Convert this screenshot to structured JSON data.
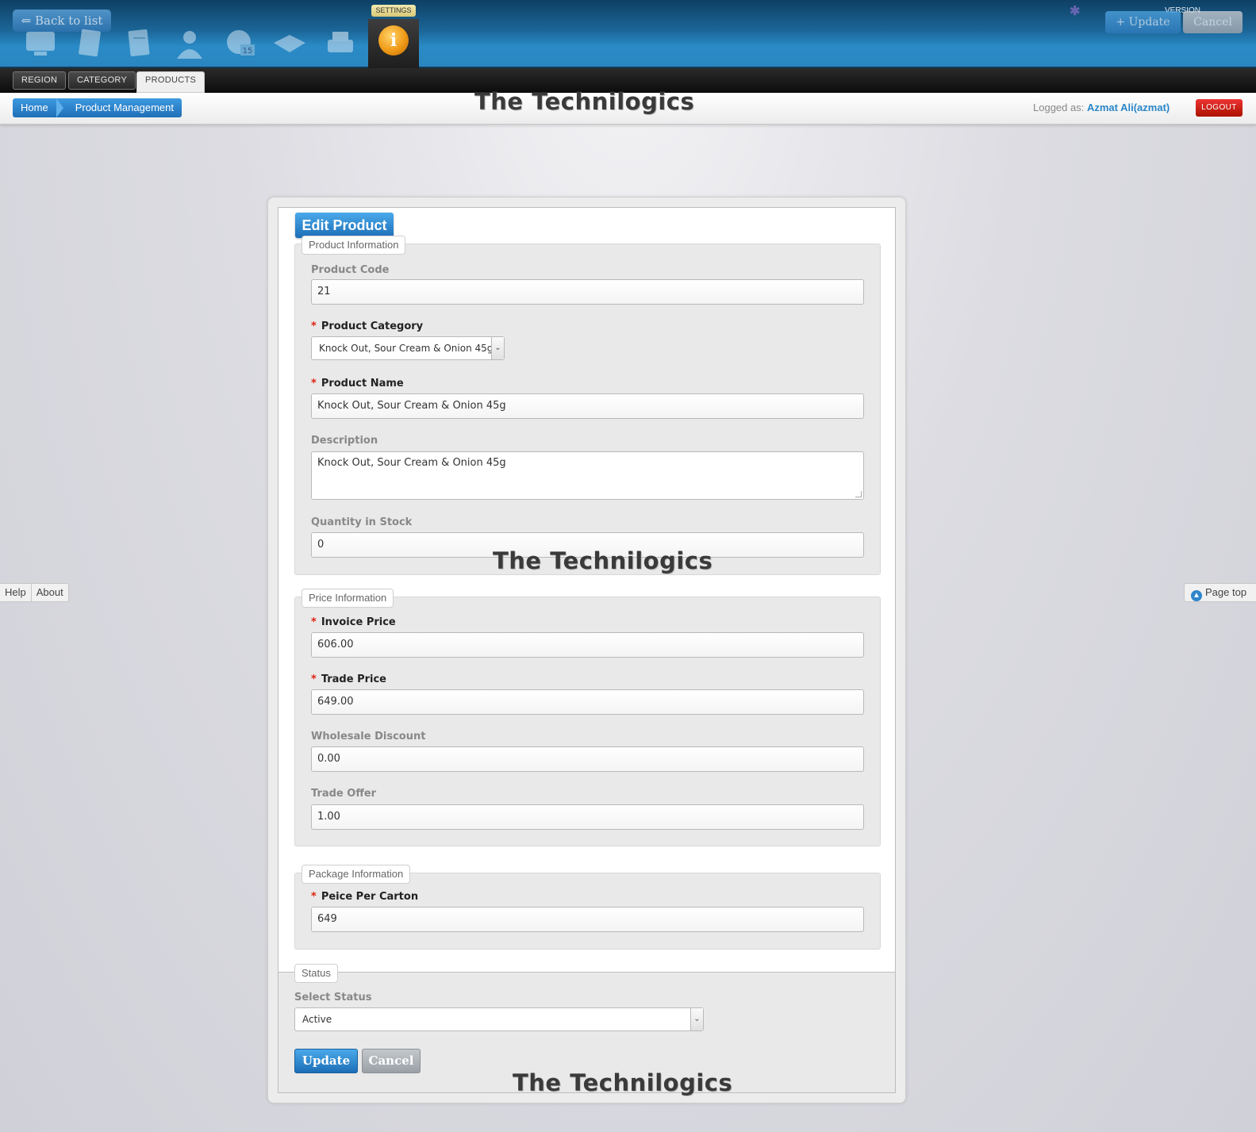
{
  "header": {
    "back_label": "⇐ Back to list",
    "settings_label": "SETTINGS",
    "info_glyph": "i",
    "version_label": "VERSION",
    "update_label": "+ Update",
    "cancel_label": "Cancel",
    "toolbar_icons": [
      "monitor-icon",
      "document-icon",
      "notepad-icon",
      "user-icon",
      "calendar-icon",
      "mail-icon",
      "printer-icon"
    ],
    "calendar_day": "15"
  },
  "tabs": [
    "REGION",
    "CATEGORY",
    "PRODUCTS"
  ],
  "active_tab": "PRODUCTS",
  "breadcrumb": {
    "home": "Home",
    "current": "Product Management"
  },
  "watermark": "The Technilogics",
  "user": {
    "logged_as_label": "Logged as:",
    "name": "Azmat Ali(azmat)",
    "logout_label": "LOGOUT"
  },
  "side": {
    "help": "Help",
    "about": "About",
    "page_top": "Page top"
  },
  "form": {
    "title": "Edit Product",
    "product_info": {
      "legend": "Product Information",
      "code_label": "Product Code",
      "code_value": "21",
      "category_label": "Product Category",
      "category_value": "Knock Out, Sour Cream & Onion 45g",
      "name_label": "Product Name",
      "name_value": "Knock Out, Sour Cream & Onion 45g",
      "description_label": "Description",
      "description_value": "Knock Out, Sour Cream & Onion 45g",
      "qty_label": "Quantity in Stock",
      "qty_value": "0"
    },
    "price_info": {
      "legend": "Price Information",
      "invoice_label": "Invoice Price",
      "invoice_value": "606.00",
      "trade_label": "Trade Price",
      "trade_value": "649.00",
      "wholesale_label": "Wholesale Discount",
      "wholesale_value": "0.00",
      "offer_label": "Trade Offer",
      "offer_value": "1.00"
    },
    "package_info": {
      "legend": "Package Information",
      "carton_label": "Peice Per Carton",
      "carton_value": "649"
    },
    "status": {
      "legend": "Status",
      "select_label": "Select Status",
      "select_value": "Active"
    },
    "update_label": "Update",
    "cancel_label": "Cancel",
    "required_mark": "*"
  },
  "colors": {
    "accent_blue": "#2a86c8",
    "logout_red": "#cc2211",
    "settings_orange": "#f09a17",
    "required_star": "#dd2211"
  }
}
